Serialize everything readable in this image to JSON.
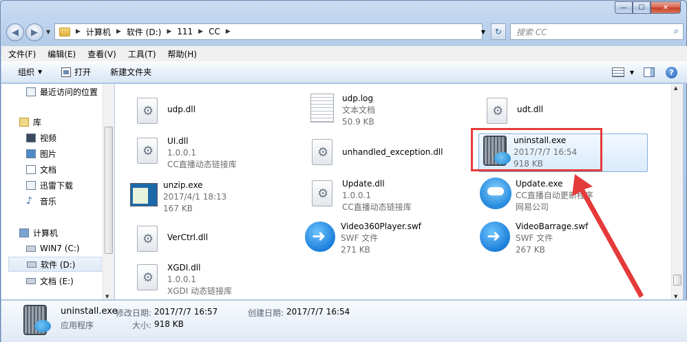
{
  "window": {
    "min": "—",
    "max": "☐",
    "close": "✕"
  },
  "address": {
    "segments": [
      "计算机",
      "软件 (D:)",
      "111",
      "CC"
    ],
    "search_placeholder": "搜索 CC"
  },
  "menu": [
    "文件(F)",
    "编辑(E)",
    "查看(V)",
    "工具(T)",
    "帮助(H)"
  ],
  "commands": {
    "organize": "组织",
    "open": "打开",
    "new_folder": "新建文件夹"
  },
  "nav": {
    "recent": "最近访问的位置",
    "library": "库",
    "video": "视频",
    "pictures": "图片",
    "documents": "文档",
    "xunlei": "迅雷下载",
    "music": "音乐",
    "computer": "计算机",
    "drive_c": "WIN7 (C:)",
    "drive_d": "软件 (D:)",
    "drive_e": "文档 (E:)"
  },
  "files": [
    {
      "name": "udp.dll",
      "line2": "",
      "line3": "",
      "icon": "dll-icon"
    },
    {
      "name": "udp.log",
      "line2": "文本文档",
      "line3": "50.9 KB",
      "icon": "text-file-icon"
    },
    {
      "name": "udt.dll",
      "line2": "",
      "line3": "",
      "icon": "dll-icon"
    },
    {
      "name": "UI.dll",
      "line2": "1.0.0.1",
      "line3": "CC直播动态链接库",
      "icon": "dll-icon"
    },
    {
      "name": "unhandled_exception.dll",
      "line2": "",
      "line3": "",
      "icon": "dll-icon"
    },
    {
      "name": "uninstall.exe",
      "line2": "2017/7/7 16:54",
      "line3": "918 KB",
      "icon": "uninstall-icon"
    },
    {
      "name": "unzip.exe",
      "line2": "2017/4/1 18:13",
      "line3": "167 KB",
      "icon": "exe-icon"
    },
    {
      "name": "Update.dll",
      "line2": "1.0.0.1",
      "line3": "CC直播动态链接库",
      "icon": "dll-icon"
    },
    {
      "name": "Update.exe",
      "line2": "CC直播自动更新程序",
      "line3": "网易公司",
      "icon": "cc-robot-icon"
    },
    {
      "name": "VerCtrl.dll",
      "line2": "",
      "line3": "",
      "icon": "dll-icon"
    },
    {
      "name": "Video360Player.swf",
      "line2": "SWF 文件",
      "line3": "271 KB",
      "icon": "swf-icon"
    },
    {
      "name": "VideoBarrage.swf",
      "line2": "SWF 文件",
      "line3": "267 KB",
      "icon": "swf-icon"
    },
    {
      "name": "XGDI.dll",
      "line2": "1.0.0.1",
      "line3": "XGDI 动态链接库",
      "icon": "dll-icon"
    }
  ],
  "details": {
    "name": "uninstall.exe",
    "type": "应用程序",
    "modified_label": "修改日期:",
    "modified_value": "2017/7/7 16:57",
    "size_label": "大小:",
    "size_value": "918 KB",
    "created_label": "创建日期:",
    "created_value": "2017/7/7 16:54"
  },
  "colors": {
    "highlight": "#e53a3a",
    "selection": "#d9ebfc"
  }
}
